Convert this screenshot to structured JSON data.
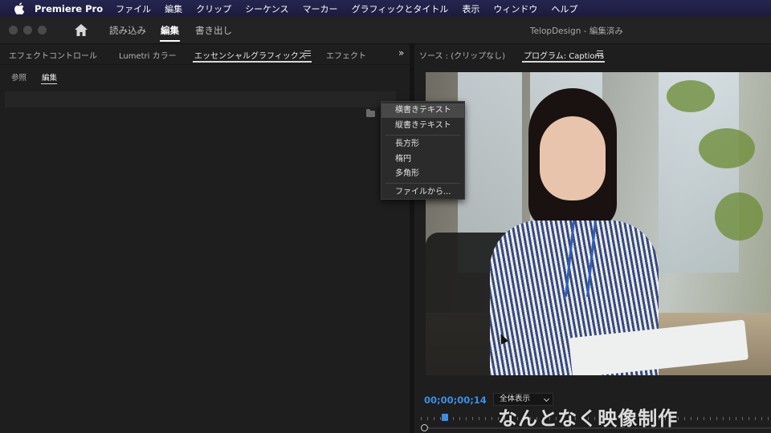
{
  "menubar": {
    "app_name": "Premiere Pro",
    "items": [
      "ファイル",
      "編集",
      "クリップ",
      "シーケンス",
      "マーカー",
      "グラフィックとタイトル",
      "表示",
      "ウィンドウ",
      "ヘルプ"
    ]
  },
  "titlebar": {
    "workspace_tabs": [
      "読み込み",
      "編集",
      "書き出し"
    ],
    "active_workspace": "編集",
    "document_title": "TelopDesign - 編集済み"
  },
  "left_panel": {
    "tabs": [
      "エフェクトコントロール",
      "Lumetri カラー",
      "エッセンシャルグラフィックス",
      "エフェクト"
    ],
    "active_tab": "エッセンシャルグラフィックス",
    "subtabs": [
      "参照",
      "編集"
    ],
    "active_subtab": "編集"
  },
  "new_layer_menu": {
    "items": [
      "横書きテキスト",
      "縦書きテキスト",
      "長方形",
      "楕円",
      "多角形",
      "ファイルから..."
    ],
    "highlighted": "横書きテキスト"
  },
  "program_monitor": {
    "source_tab": "ソース : (クリップなし)",
    "program_tab": "プログラム: Captions",
    "timecode": "00;00;00;14",
    "zoom_label": "全体表示"
  },
  "watermark": "なんとなく映像制作",
  "colors": {
    "accent_blue": "#3d8ee6",
    "menubar_bg": "#22214a",
    "panel_bg": "#1e1e1e"
  }
}
